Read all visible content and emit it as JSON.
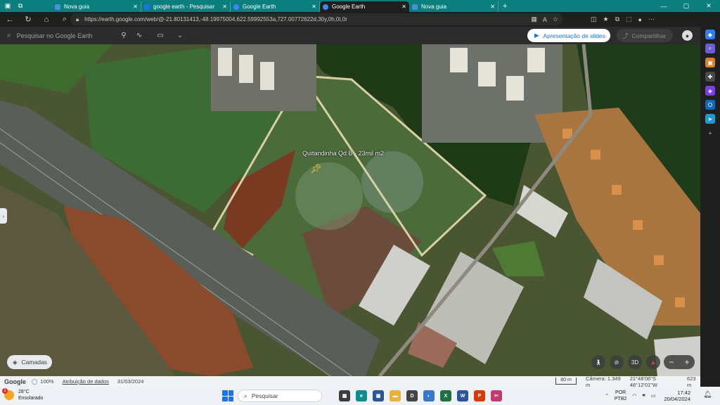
{
  "browser": {
    "tabs": [
      {
        "title": "Nova guia",
        "favicon_color": "#4a90d9",
        "active": false
      },
      {
        "title": "google earth - Pesquisar",
        "favicon_color": "#1a73e8",
        "active": false
      },
      {
        "title": "Google Earth",
        "favicon_color": "#4285f4",
        "active": false
      },
      {
        "title": "Google Earth",
        "favicon_color": "#4285f4",
        "active": true
      },
      {
        "title": "Nova guia",
        "favicon_color": "#4a90d9",
        "active": false
      }
    ],
    "new_tab_symbol": "+",
    "url": "https://earth.google.com/web/@-21.80131413,-48.19975004,622.59992553a,727.00772622d,30y,0h,0t,0r",
    "accent_color": "#0b7e7e"
  },
  "earth": {
    "search_placeholder": "Pesquisar no Google Earth",
    "slides_label": "Apresentação de slides",
    "share_label": "Compartilhar",
    "placemark_label": "Quitandinha Qd B - 23mil m2",
    "layers_label": "Camadas",
    "view_3d_label": "3D",
    "zoom_out": "−",
    "zoom_in": "+",
    "status": {
      "logo": "Google",
      "coverage": "100%",
      "attribution": "Atribuição de dados",
      "date": "31/03/2024",
      "scale": "80 m",
      "camera": "Câmera: 1.349 m",
      "coords": "21°48'06\"S 48°12'01\"W",
      "elevation": "623 m"
    }
  },
  "taskbar": {
    "weather_temp": "28°C",
    "weather_desc": "Ensolarado",
    "weather_badge": "1",
    "search_label": "Pesquisar",
    "lang_1": "POR",
    "lang_2": "PTB2",
    "time": "17:42",
    "date": "20/04/2024"
  }
}
